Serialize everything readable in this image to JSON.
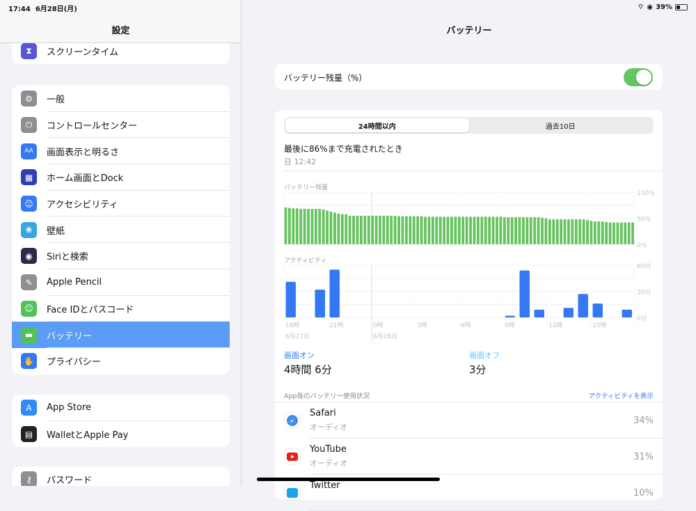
{
  "status": {
    "time": "17:44",
    "date": "6月28日(月)",
    "battery_pct": "39%",
    "battery_level": 0.39
  },
  "sidebar": {
    "title": "設定",
    "top_item": {
      "label": "スクリーンタイム",
      "icon": "hourglass-icon",
      "color": "#5856d6"
    },
    "groups": [
      [
        {
          "label": "一般",
          "icon": "gear-icon",
          "color": "#8e8e93"
        },
        {
          "label": "コントロールセンター",
          "icon": "switches-icon",
          "color": "#8e8e93"
        },
        {
          "label": "画面表示と明るさ",
          "icon": "text-size-icon",
          "color": "#3478f6"
        },
        {
          "label": "ホーム画面とDock",
          "icon": "app-grid-icon",
          "color": "#2c3fb8"
        },
        {
          "label": "アクセシビリティ",
          "icon": "accessibility-icon",
          "color": "#3478f6"
        },
        {
          "label": "壁紙",
          "icon": "flower-icon",
          "color": "#37a6e0"
        },
        {
          "label": "Siriと検索",
          "icon": "siri-icon",
          "color": "#2a2a4a"
        },
        {
          "label": "Apple Pencil",
          "icon": "pencil-icon",
          "color": "#8e8e93"
        },
        {
          "label": "Face IDとパスコード",
          "icon": "face-id-icon",
          "color": "#52c15a"
        },
        {
          "label": "バッテリー",
          "icon": "battery-icon",
          "color": "#52c15a",
          "selected": true
        },
        {
          "label": "プライバシー",
          "icon": "hand-icon",
          "color": "#3478f6"
        }
      ],
      [
        {
          "label": "App Store",
          "icon": "app-store-icon",
          "color": "#2f8cf5"
        },
        {
          "label": "WalletとApple Pay",
          "icon": "wallet-icon",
          "color": "#222"
        }
      ],
      [
        {
          "label": "パスワード",
          "icon": "key-icon",
          "color": "#8e8e93"
        }
      ]
    ]
  },
  "main": {
    "title": "バッテリー",
    "battery_pct_toggle": {
      "label": "バッテリー残量（%）",
      "on": true
    },
    "tabs": [
      {
        "label": "24時間以内",
        "active": true
      },
      {
        "label": "過去10日",
        "active": false
      }
    ],
    "last_charge": {
      "text": "最後に86%まで充電されたとき",
      "time": "日 12:42"
    },
    "screen_on": {
      "label": "画面オン",
      "value": "4時間 6分"
    },
    "screen_off": {
      "label": "画面オフ",
      "value": "3分"
    },
    "usage_header": "App毎のバッテリー使用状況",
    "show_activity": "アクティビティを表示",
    "apps": [
      {
        "name": "Safari",
        "sub": "オーディオ",
        "pct": "34%",
        "icon": "safari-icon"
      },
      {
        "name": "YouTube",
        "sub": "オーディオ",
        "pct": "31%",
        "icon": "youtube-icon"
      },
      {
        "name": "Twitter",
        "sub": "",
        "pct": "10%",
        "icon": "twitter-icon"
      }
    ]
  },
  "chart_data": [
    {
      "type": "bar",
      "title": "バッテリー残量",
      "ylim": [
        0,
        100
      ],
      "yticks": [
        "100%",
        "50%",
        "0%"
      ],
      "values": [
        71,
        70,
        69,
        69,
        68,
        68,
        68,
        68,
        68,
        68,
        67,
        65,
        63,
        61,
        59,
        58,
        58,
        55,
        55,
        55,
        55,
        55,
        55,
        55,
        55,
        55,
        55,
        55,
        55,
        55,
        54,
        54,
        54,
        54,
        54,
        54,
        54,
        53,
        53,
        53,
        53,
        53,
        53,
        53,
        53,
        53,
        53,
        53,
        53,
        53,
        53,
        53,
        53,
        53,
        53,
        53,
        53,
        53,
        52,
        52,
        52,
        52,
        52,
        52,
        52,
        52,
        52,
        52,
        51,
        50,
        48,
        48,
        48,
        48,
        48,
        48,
        48,
        48,
        48,
        48,
        47,
        45,
        44,
        44,
        44,
        43,
        42,
        42,
        42,
        42,
        42,
        42,
        42
      ]
    },
    {
      "type": "bar",
      "title": "アクティビティ",
      "ylim": [
        0,
        60
      ],
      "yticks": [
        "60分",
        "30分",
        "0分"
      ],
      "categories": [
        "18",
        "19",
        "20",
        "21",
        "22",
        "23",
        "0",
        "1",
        "2",
        "3",
        "4",
        "5",
        "6",
        "7",
        "8",
        "9",
        "10",
        "11",
        "12",
        "13",
        "14",
        "15",
        "16",
        "17"
      ],
      "values": [
        41,
        0,
        32,
        55,
        0,
        0,
        0,
        0,
        0,
        0,
        0,
        0,
        0,
        0,
        0,
        2,
        54,
        9,
        0,
        11,
        27,
        16,
        0,
        9
      ],
      "xlabels": [
        {
          "at": 0,
          "text": "18時"
        },
        {
          "at": 3,
          "text": "21時"
        },
        {
          "at": 6,
          "text": "0時"
        },
        {
          "at": 9,
          "text": "3時"
        },
        {
          "at": 12,
          "text": "6時"
        },
        {
          "at": 15,
          "text": "9時"
        },
        {
          "at": 18,
          "text": "12時"
        },
        {
          "at": 21,
          "text": "15時"
        }
      ],
      "date_labels": [
        {
          "at": 0,
          "text": "6月27日"
        },
        {
          "at": 6,
          "text": "6月28日"
        }
      ]
    }
  ]
}
